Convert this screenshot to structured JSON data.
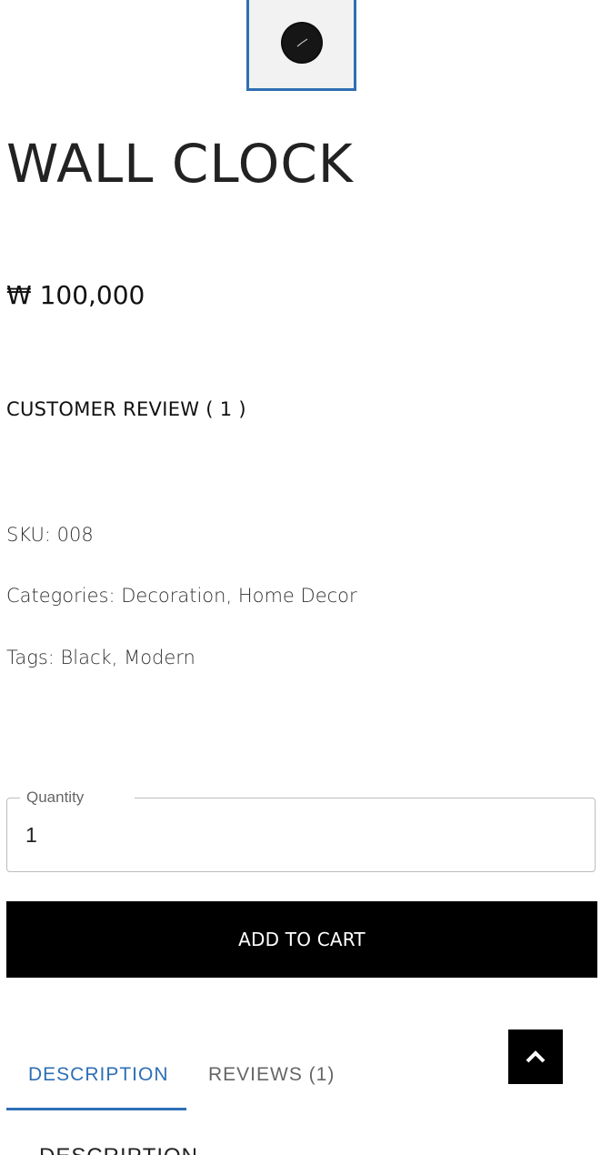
{
  "product": {
    "title": "WALL CLOCK",
    "price": "₩ 100,000",
    "review_link": "CUSTOMER REVIEW ( 1 )",
    "thumbnail_icon": "wall-clock-image"
  },
  "meta": {
    "sku_label": "SKU:",
    "sku_value": "008",
    "categories_label": "Categories:",
    "categories": [
      "Decoration",
      "Home Decor"
    ],
    "tags_label": "Tags:",
    "tags": [
      "Black",
      "Modern"
    ],
    "separator": ","
  },
  "quantity": {
    "label": "Quantity",
    "value": "1"
  },
  "cart": {
    "add_label": "ADD TO CART"
  },
  "tabs": [
    {
      "label": "DESCRIPTION",
      "active": true
    },
    {
      "label": "REVIEWS (1)",
      "active": false
    }
  ],
  "description": {
    "heading": "DESCRIPTION"
  },
  "scroll_top": {
    "icon": "chevron-up-icon"
  },
  "colors": {
    "accent": "#2e6fb5",
    "button_bg": "#000000",
    "button_text": "#ffffff"
  }
}
